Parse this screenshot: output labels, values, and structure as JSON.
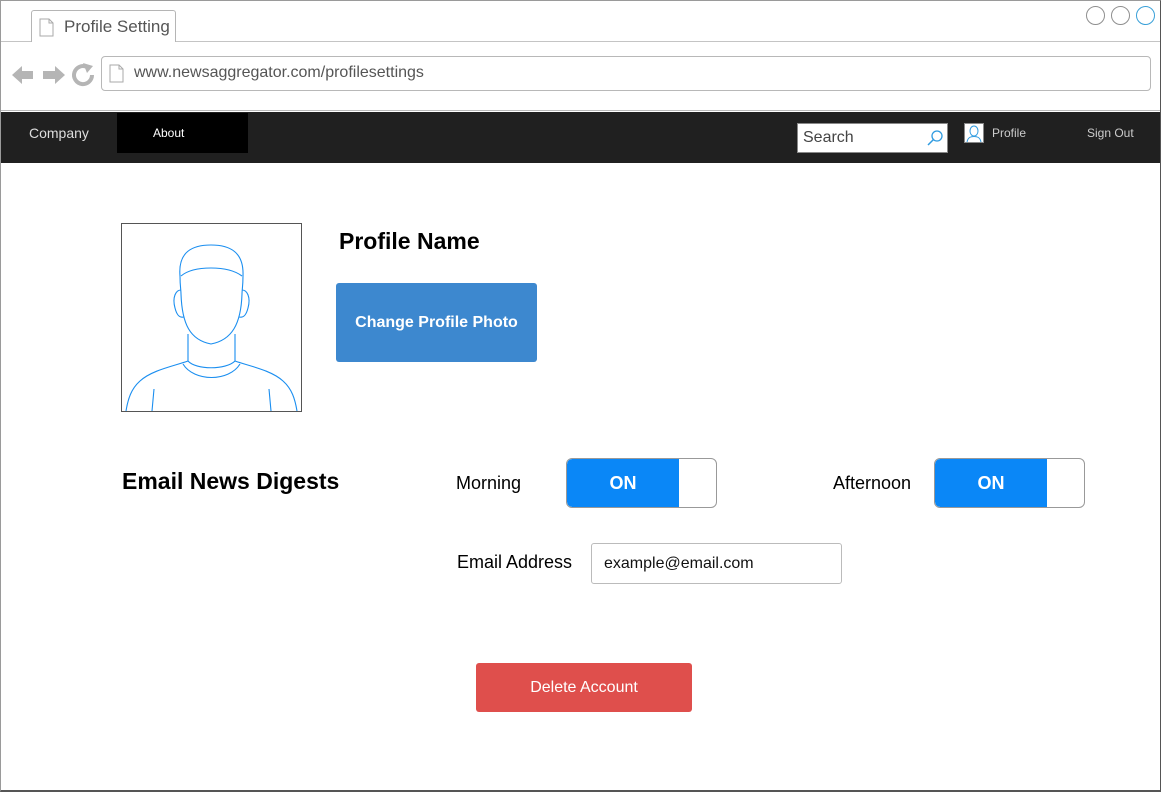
{
  "browser": {
    "tab_title": "Profile Setting",
    "url": "www.newsaggregator.com/profilesettings"
  },
  "navbar": {
    "company": "Company",
    "about": "About",
    "search_placeholder": "Search",
    "profile": "Profile",
    "sign_out": "Sign Out"
  },
  "profile": {
    "name": "Profile Name",
    "change_photo_label": "Change Profile Photo"
  },
  "digests": {
    "heading": "Email News Digests",
    "morning": {
      "label": "Morning",
      "state": "ON"
    },
    "afternoon": {
      "label": "Afternoon",
      "state": "ON"
    },
    "email_label": "Email Address",
    "email_value": "example@email.com"
  },
  "actions": {
    "delete_label": "Delete Account"
  },
  "colors": {
    "toggle_on": "#0a87f7",
    "change_photo": "#3d88cf",
    "delete": "#df4f4c",
    "navbar": "#202020"
  }
}
